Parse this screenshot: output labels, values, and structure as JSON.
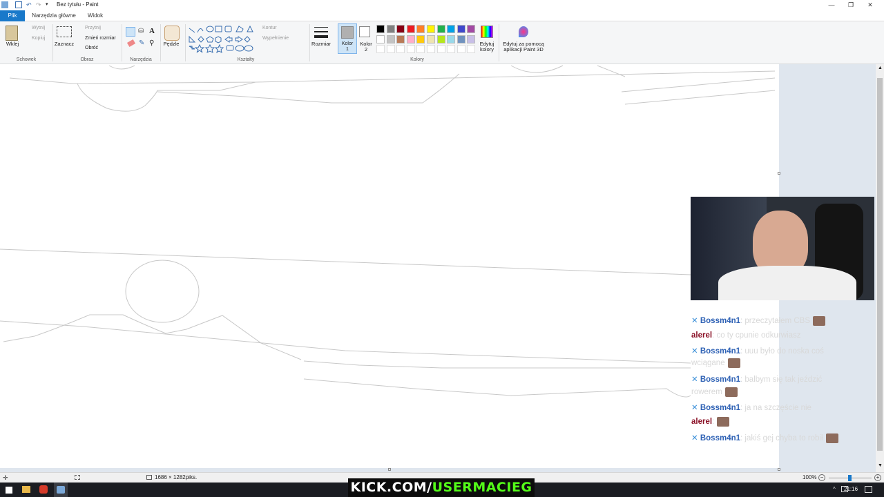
{
  "window": {
    "title": "Bez tytułu - Paint",
    "minimize_icon": "—",
    "restore_icon": "❐",
    "close_icon": "✕"
  },
  "tabs": [
    {
      "label": "Plik",
      "active": true
    },
    {
      "label": "Narzędzia główne",
      "active": false
    },
    {
      "label": "Widok",
      "active": false
    }
  ],
  "ribbon": {
    "clipboard": {
      "paste": "Wklej",
      "cut": "Wytnij",
      "copy": "Kopiuj",
      "group": "Schowek"
    },
    "image": {
      "select": "Zaznacz",
      "crop": "Przytnij",
      "resize": "Zmień rozmiar",
      "rotate": "Obróć",
      "group": "Obraz"
    },
    "tools": {
      "group": "Narzędzia"
    },
    "brushes": {
      "label": "Pędzle"
    },
    "shapes": {
      "outline": "Kontur",
      "fill": "Wypełnienie",
      "group": "Kształty"
    },
    "size": {
      "label": "Rozmiar"
    },
    "colors": {
      "color1": "Kolor 1",
      "color1_l1": "Kolor",
      "color1_l2": "1",
      "color2_l1": "Kolor",
      "color2_l2": "2",
      "edit_l1": "Edytuj",
      "edit_l2": "kolory",
      "paint3d_l1": "Edytuj za pomocą",
      "paint3d_l2": "aplikacji Paint 3D",
      "group": "Kolory",
      "palette_row1": [
        "#000000",
        "#7f7f7f",
        "#880015",
        "#ed1c24",
        "#ff7f27",
        "#fff200",
        "#22b14c",
        "#00a2e8",
        "#3f48cc",
        "#a349a4"
      ],
      "palette_row2": [
        "#ffffff",
        "#c3c3c3",
        "#b97a57",
        "#ffaec9",
        "#ffc90e",
        "#efe4b0",
        "#b5e61d",
        "#99d9ea",
        "#7092be",
        "#c8bfe7"
      ]
    }
  },
  "status": {
    "dimensions": "1686 × 1282piks.",
    "zoom": "100%"
  },
  "taskbar": {
    "time": "21:16"
  },
  "chat": [
    {
      "user": "Bossm4n1",
      "message": ": przeczytałem CBS",
      "emote": true,
      "red": false
    },
    {
      "user": "alerel",
      "message": ": co ty cpunie odkurwiasz",
      "emote": false,
      "red": true
    },
    {
      "user": "Bossm4n1",
      "message": ": uuu było do noska coś",
      "emote": false,
      "red": false
    },
    {
      "user": "",
      "message": "wciągane",
      "emote": true,
      "red": false
    },
    {
      "user": "Bossm4n1",
      "message": ": balbym się tak jeździć",
      "emote": false,
      "red": false
    },
    {
      "user": "",
      "message": "rowerem",
      "emote": true,
      "red": false
    },
    {
      "user": "Bossm4n1",
      "message": ": ja na szczęście nie",
      "emote": false,
      "red": false
    },
    {
      "user": "alerel",
      "message": ":",
      "emote": true,
      "red": true
    },
    {
      "user": "Bossm4n1",
      "message": ": jakiś gej chyba to robił",
      "emote": true,
      "red": false
    }
  ],
  "banner": {
    "part1": "KICK.COM/",
    "part2": "USERMACIEG"
  }
}
